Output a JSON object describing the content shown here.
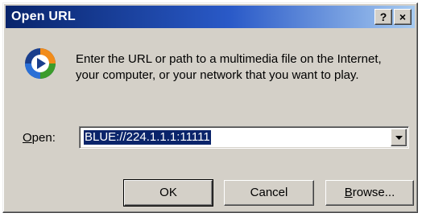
{
  "dialog": {
    "title": "Open URL",
    "help_button": "?",
    "close_button": "×",
    "message": "Enter the URL or path to a multimedia file on the Internet, your computer, or your network that you want to play.",
    "open_label_ul": "O",
    "open_label_rest": "pen:",
    "url_value": "BLUE://224.1.1.1:11111",
    "ok_label": "OK",
    "cancel_label": "Cancel",
    "browse_label_ul": "B",
    "browse_label_rest": "rowse...",
    "icon": "windows-media-player-icon"
  },
  "colors": {
    "titlebar_start": "#08246b",
    "titlebar_end": "#a6caf0",
    "selection": "#0a246a",
    "face": "#d4d0c8"
  }
}
